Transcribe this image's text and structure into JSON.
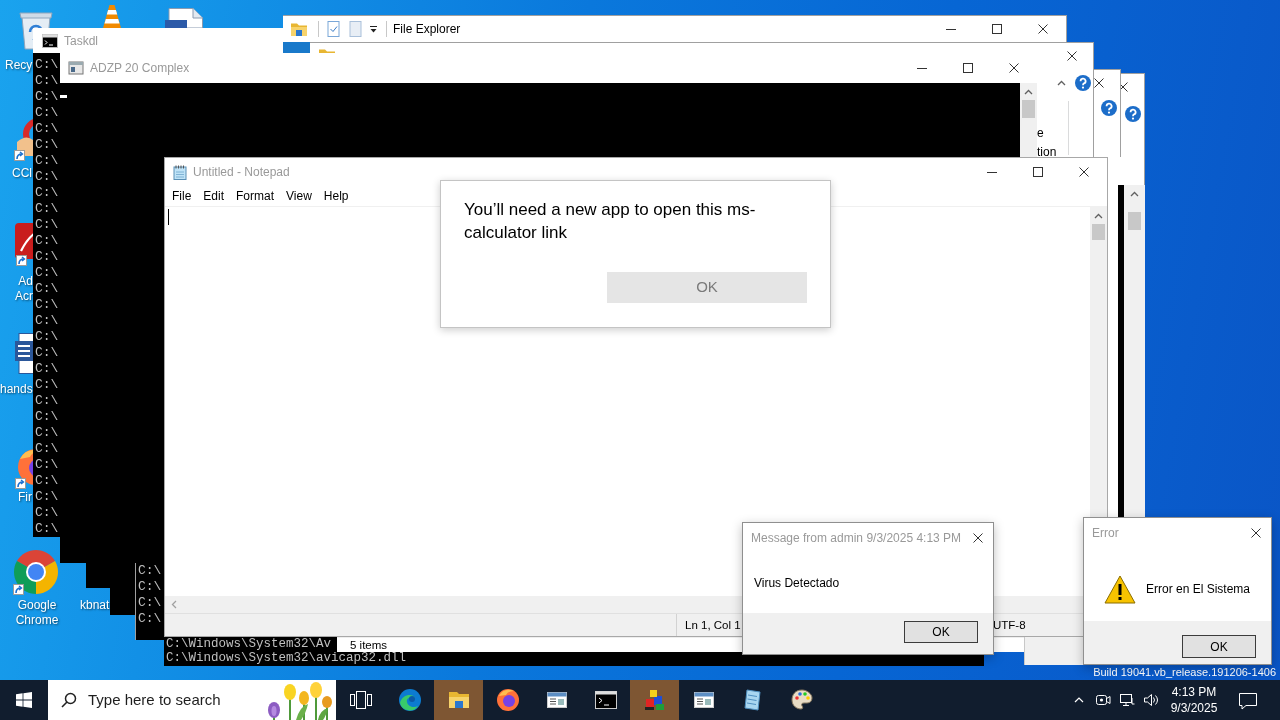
{
  "desktop": {
    "shortcuts": [
      {
        "kind": "recycle-bin",
        "label": "Recy"
      },
      {
        "kind": "vlc"
      },
      {
        "kind": "document"
      },
      {
        "kind": "ccleaner",
        "label": "CCl"
      },
      {
        "kind": "acrobat",
        "label": "Ad Acr"
      },
      {
        "kind": "word",
        "label": "hands"
      },
      {
        "kind": "firefox",
        "label": "Fir"
      },
      {
        "kind": "chrome",
        "label": "Google Chrome"
      },
      {
        "label": "kbnat"
      }
    ],
    "build_text": "Build 19041.vb_release.191206-1406"
  },
  "windows": [
    {
      "kind": "console",
      "lines": [
        "C:\\Windows\\System32\\Av",
        "C:\\Windows\\System32\\avicap32.dll"
      ]
    },
    {
      "kind": "console"
    },
    {
      "kind": "console"
    },
    {
      "kind": "console",
      "lines": [
        "C:\\",
        "C:\\",
        "C:\\",
        "C:\\"
      ]
    },
    {
      "kind": "console",
      "title": "Taskdl",
      "lines": [
        "C:\\",
        "C:\\",
        "C:\\",
        "C:\\",
        "C:\\",
        "C:\\",
        "C:\\",
        "C:\\",
        "C:\\",
        "C:\\",
        "C:\\",
        "C:\\",
        "C:\\",
        "C:\\",
        "C:\\",
        "C:\\",
        "C:\\",
        "C:\\",
        "C:\\",
        "C:\\",
        "C:\\",
        "C:\\",
        "C:\\",
        "C:\\",
        "C:\\",
        "C:\\",
        "C:\\",
        "C:\\",
        "C:\\",
        "C:\\"
      ]
    },
    {
      "kind": "explorer"
    },
    {
      "kind": "explorer",
      "status": "5 items"
    },
    {
      "kind": "console"
    },
    {
      "kind": "explorer",
      "title": "File Explorer"
    },
    {
      "kind": "explorer",
      "ribbon_labels": [
        "e",
        "tion"
      ]
    },
    {
      "kind": "console",
      "title": "ADZP 20 Complex"
    }
  ],
  "notepad": {
    "title": "Untitled - Notepad",
    "menu": [
      "File",
      "Edit",
      "Format",
      "View",
      "Help"
    ],
    "status": [
      "Ln 1, Col 1",
      "UTF-8"
    ]
  },
  "app_prompt": {
    "message": "You’ll need a new app to open this ms-calculator link",
    "button": "OK"
  },
  "message_box": {
    "title": "Message from admin 9/3/2025 4:13 PM",
    "message": "Virus Detectado",
    "button": "OK"
  },
  "error_dialog": {
    "title": "Error",
    "message": "Error en El Sistema",
    "button": "OK"
  },
  "taskbar": {
    "search": {
      "placeholder": "Type here to search"
    },
    "apps": [
      {
        "kind": "edge",
        "flashing": false
      },
      {
        "kind": "explorer",
        "flashing": true
      },
      {
        "kind": "firefox",
        "flashing": false
      },
      {
        "kind": "window",
        "flashing": false
      },
      {
        "kind": "terminal",
        "flashing": false
      },
      {
        "kind": "blocks",
        "flashing": true
      },
      {
        "kind": "window",
        "flashing": false
      },
      {
        "kind": "page",
        "flashing": false
      },
      {
        "kind": "palette",
        "flashing": false
      }
    ],
    "clock": {
      "time": "4:13 PM",
      "date": "9/3/2025"
    }
  }
}
